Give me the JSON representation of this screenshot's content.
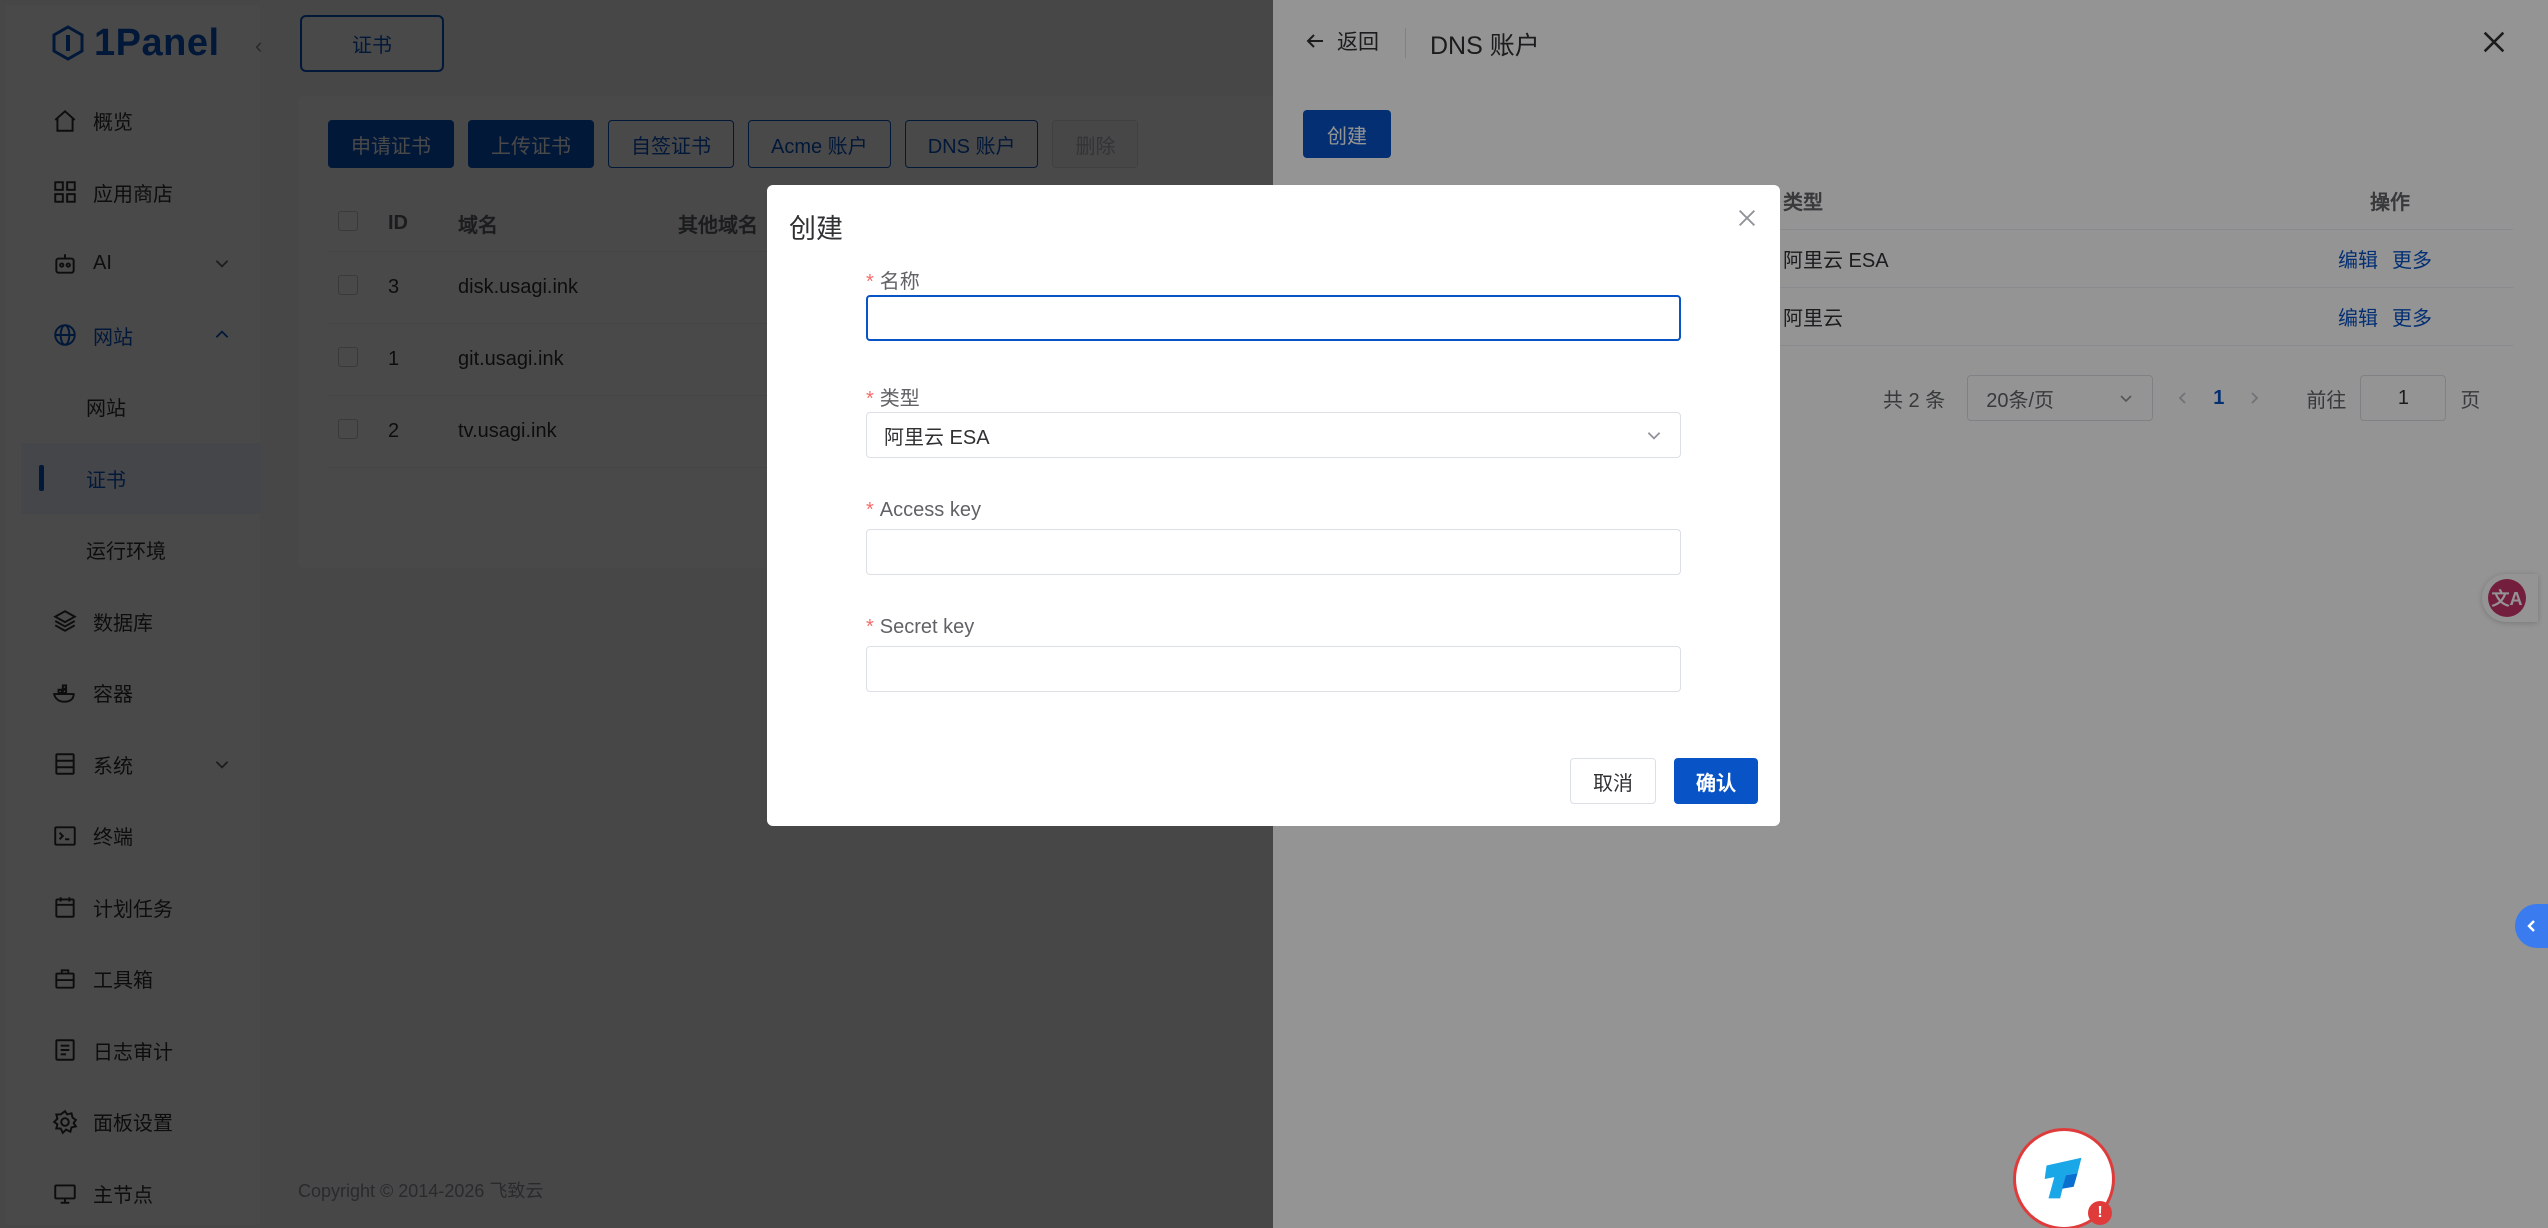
{
  "app": {
    "logo_text": "1Panel"
  },
  "sidebar": {
    "items": [
      {
        "label": "概览",
        "icon": "home-icon"
      },
      {
        "label": "应用商店",
        "icon": "apps-icon"
      },
      {
        "label": "AI",
        "icon": "robot-icon"
      },
      {
        "label": "网站",
        "icon": "globe-icon"
      },
      {
        "label": "网站"
      },
      {
        "label": "证书"
      },
      {
        "label": "运行环境"
      },
      {
        "label": "数据库",
        "icon": "database-icon"
      },
      {
        "label": "容器",
        "icon": "container-icon"
      },
      {
        "label": "系统",
        "icon": "system-icon"
      },
      {
        "label": "终端",
        "icon": "terminal-icon"
      },
      {
        "label": "计划任务",
        "icon": "calendar-icon"
      },
      {
        "label": "工具箱",
        "icon": "toolbox-icon"
      },
      {
        "label": "日志审计",
        "icon": "log-icon"
      },
      {
        "label": "面板设置",
        "icon": "settings-icon"
      },
      {
        "label": "主节点",
        "icon": "node-icon"
      }
    ]
  },
  "main": {
    "tab_label": "证书",
    "toolbar": {
      "apply": "申请证书",
      "upload": "上传证书",
      "self_signed": "自签证书",
      "acme": "Acme 账户",
      "dns": "DNS 账户",
      "delete": "删除"
    },
    "table": {
      "headers": {
        "id": "ID",
        "domain": "域名",
        "other": "其他域名"
      },
      "rows": [
        {
          "id": "3",
          "domain": "disk.usagi.ink"
        },
        {
          "id": "1",
          "domain": "git.usagi.ink"
        },
        {
          "id": "2",
          "domain": "tv.usagi.ink"
        }
      ]
    },
    "copyright": "Copyright © 2014-2026 飞致云"
  },
  "drawer": {
    "back": "返回",
    "title": "DNS 账户",
    "create": "创建",
    "headers": {
      "type": "类型",
      "ops": "操作"
    },
    "rows": [
      {
        "type": "阿里云 ESA",
        "edit": "编辑",
        "more": "更多"
      },
      {
        "type": "阿里云",
        "edit": "编辑",
        "more": "更多"
      }
    ],
    "pager": {
      "total": "共 2 条",
      "page_size": "20条/页",
      "current": "1",
      "goto": "前往",
      "goto_value": "1",
      "page_suffix": "页"
    }
  },
  "modal": {
    "title": "创建",
    "fields": {
      "name_label": "名称",
      "name_value": "",
      "type_label": "类型",
      "type_value": "阿里云 ESA",
      "access_key_label": "Access key",
      "access_key_value": "",
      "secret_key_label": "Secret key",
      "secret_key_value": ""
    },
    "cancel": "取消",
    "confirm": "确认"
  },
  "widgets": {
    "translate_glyph": "文A",
    "assistant_alert": "!"
  },
  "colors": {
    "primary": "#0854c7",
    "required": "#f56c6c"
  }
}
